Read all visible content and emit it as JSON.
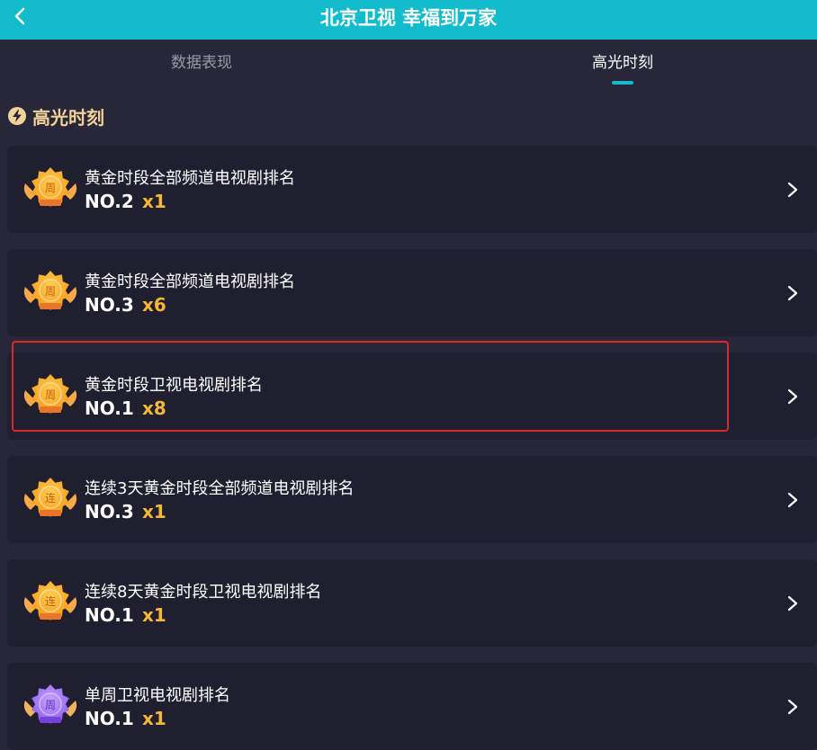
{
  "header": {
    "title": "北京卫视 幸福到万家",
    "back_icon": "chevron-left-icon"
  },
  "tabs": [
    {
      "label": "数据表现",
      "active": false
    },
    {
      "label": "高光时刻",
      "active": true
    }
  ],
  "section": {
    "title": "高光时刻",
    "icon": "lightning-icon"
  },
  "colors": {
    "header_bg": "#13bccd",
    "page_bg": "#272739",
    "card_bg": "#1f1f2f",
    "accent_gold": "#f5b736",
    "section_title": "#f3d29a",
    "highlight_border": "#e02626"
  },
  "cards": [
    {
      "title": "黄金时段全部频道电视剧排名",
      "rank": "NO.2",
      "count": "x1",
      "badge_char": "周",
      "badge_style": "gold"
    },
    {
      "title": "黄金时段全部频道电视剧排名",
      "rank": "NO.3",
      "count": "x6",
      "badge_char": "周",
      "badge_style": "gold"
    },
    {
      "title": "黄金时段卫视电视剧排名",
      "rank": "NO.1",
      "count": "x8",
      "badge_char": "周",
      "badge_style": "gold"
    },
    {
      "title": "连续3天黄金时段全部频道电视剧排名",
      "rank": "NO.3",
      "count": "x1",
      "badge_char": "连",
      "badge_style": "gold"
    },
    {
      "title": "连续8天黄金时段卫视电视剧排名",
      "rank": "NO.1",
      "count": "x1",
      "badge_char": "连",
      "badge_style": "gold"
    },
    {
      "title": "单周卫视电视剧排名",
      "rank": "NO.1",
      "count": "x1",
      "badge_char": "周",
      "badge_style": "purple"
    }
  ]
}
